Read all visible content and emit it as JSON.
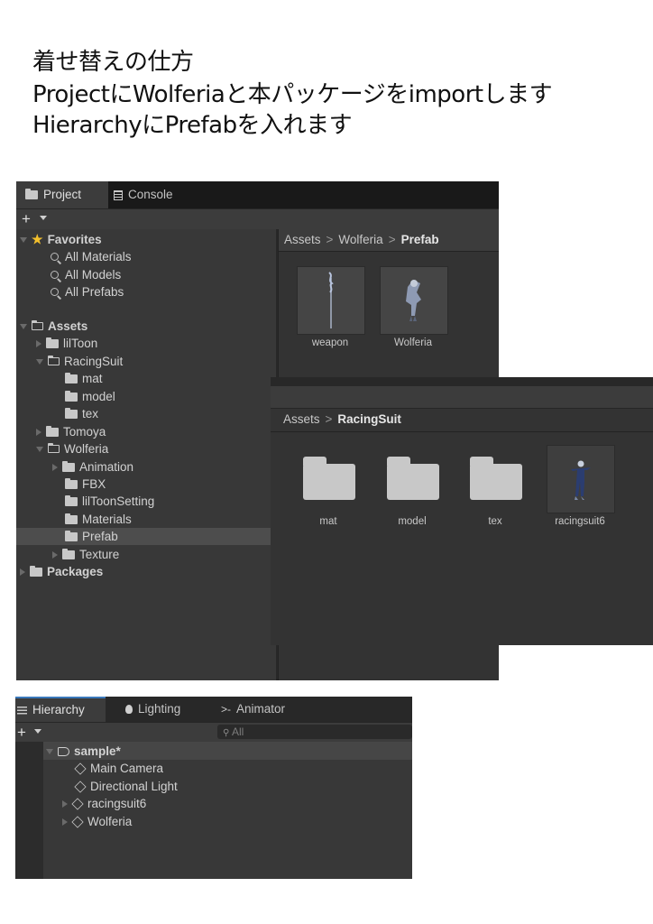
{
  "heading": {
    "line1": "着せ替えの仕方",
    "line2": "ProjectにWolferiaと本パッケージをimportします",
    "line3": "HierarchyにPrefabを入れます"
  },
  "project_window": {
    "tabs": [
      {
        "label": "Project",
        "icon": "folder-icon",
        "active": true
      },
      {
        "label": "Console",
        "icon": "console-icon",
        "active": false
      }
    ],
    "favorites": {
      "label": "Favorites",
      "items": [
        "All Materials",
        "All Models",
        "All Prefabs"
      ]
    },
    "assets_label": "Assets",
    "tree": [
      {
        "label": "lilToon"
      },
      {
        "label": "RacingSuit"
      },
      {
        "label": "mat"
      },
      {
        "label": "model"
      },
      {
        "label": "tex"
      },
      {
        "label": "Tomoya"
      },
      {
        "label": "Wolferia"
      },
      {
        "label": "Animation"
      },
      {
        "label": "FBX"
      },
      {
        "label": "lilToonSetting"
      },
      {
        "label": "Materials"
      },
      {
        "label": "Prefab",
        "selected": true
      },
      {
        "label": "Texture"
      }
    ],
    "packages_label": "Packages",
    "breadcrumb": {
      "root": "Assets",
      "mid": "Wolferia",
      "current": "Prefab"
    },
    "prefab_items": [
      {
        "label": "weapon",
        "icon": "weapon-preview"
      },
      {
        "label": "Wolferia",
        "icon": "character-preview"
      }
    ]
  },
  "racingsuit_window": {
    "breadcrumb": {
      "root": "Assets",
      "current": "RacingSuit"
    },
    "items": [
      {
        "label": "mat",
        "icon": "folder-icon"
      },
      {
        "label": "model",
        "icon": "folder-icon"
      },
      {
        "label": "tex",
        "icon": "folder-icon"
      },
      {
        "label": "racingsuit6",
        "icon": "character-preview"
      }
    ]
  },
  "hierarchy_window": {
    "tabs": [
      {
        "label": "Hierarchy",
        "icon": "list-icon",
        "active": true
      },
      {
        "label": "Lighting",
        "icon": "bulb-icon",
        "active": false
      },
      {
        "label": "Animator",
        "icon": "animator-icon",
        "active": false
      }
    ],
    "search_placeholder": "All",
    "scene": "sample*",
    "objects": [
      {
        "label": "Main Camera"
      },
      {
        "label": "Directional Light"
      },
      {
        "label": "racingsuit6"
      },
      {
        "label": "Wolferia"
      }
    ]
  },
  "colors": {
    "selection_bar": "#2c5d87",
    "favorite_star": "#f3c02c",
    "panel_bg": "#383838"
  }
}
